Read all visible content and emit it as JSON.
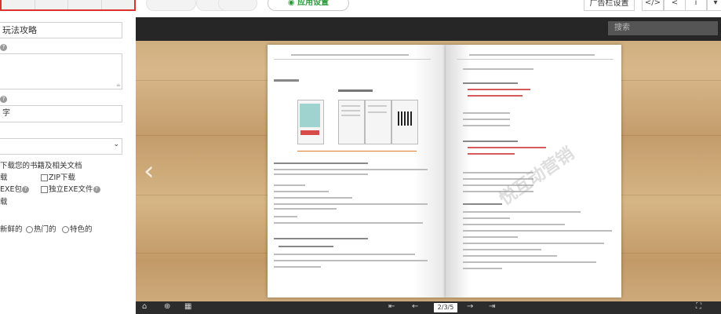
{
  "toolbar": {
    "app_settings_label": "应用设置",
    "ad_settings_label": "广告栏设置",
    "code_icon_label": "</>",
    "info_icon_label": "i"
  },
  "form": {
    "title_value": "玩法攻略",
    "keywords_value": "字",
    "download_section_label": "下载您的书籍及相关文档",
    "opt_download_label": "载",
    "opt_zip_label": "ZIP下载",
    "opt_exe_pack_label": "EXE包",
    "opt_standalone_exe_label": "独立EXE文件",
    "opt_download2_label": "载",
    "sort_newest_label": "新鲜的",
    "sort_hot_label": "热门的",
    "sort_featured_label": "特色的"
  },
  "viewer": {
    "search_placeholder": "搜索",
    "page_counter": "2/3/5",
    "watermark_text": "悦互动营销"
  },
  "colors": {
    "accent_green": "#2c9a3c",
    "highlight_red": "#e0302c",
    "viewer_dark": "#262626"
  }
}
